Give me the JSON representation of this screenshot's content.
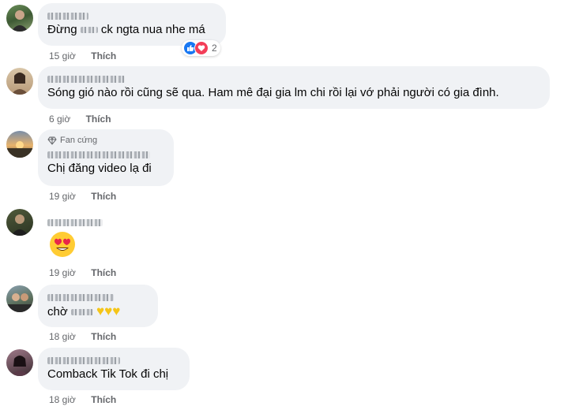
{
  "like_label": "Thích",
  "comments": [
    {
      "text": "Đừng ... ck ngta nua nhe má",
      "text_before": "Đừng",
      "text_after": "ck ngta nua nhe má",
      "time": "15 giờ",
      "reaction_count": "2",
      "reaction_icons": [
        "like-icon",
        "love-icon"
      ],
      "colors": {
        "like": "#1877f2",
        "love": "#f33e58"
      }
    },
    {
      "text": "Sóng gió nào rồi cũng sẽ qua. Ham mê đại gia lm chi rồi lại vớ phải người có gia đình.",
      "time": "6 giờ"
    },
    {
      "badge": "Fan cứng",
      "badge_icon": "diamond-icon",
      "text": "Chị đăng video lạ đi",
      "time": "19 giờ"
    },
    {
      "emoji": "heart-eyes-emoji",
      "time": "19 giờ"
    },
    {
      "text_before": "chờ",
      "emoji": "yellow-heart-emoji x3",
      "time": "18 giờ"
    },
    {
      "text": "Comback Tik Tok đi chị",
      "time": "18 giờ"
    }
  ]
}
